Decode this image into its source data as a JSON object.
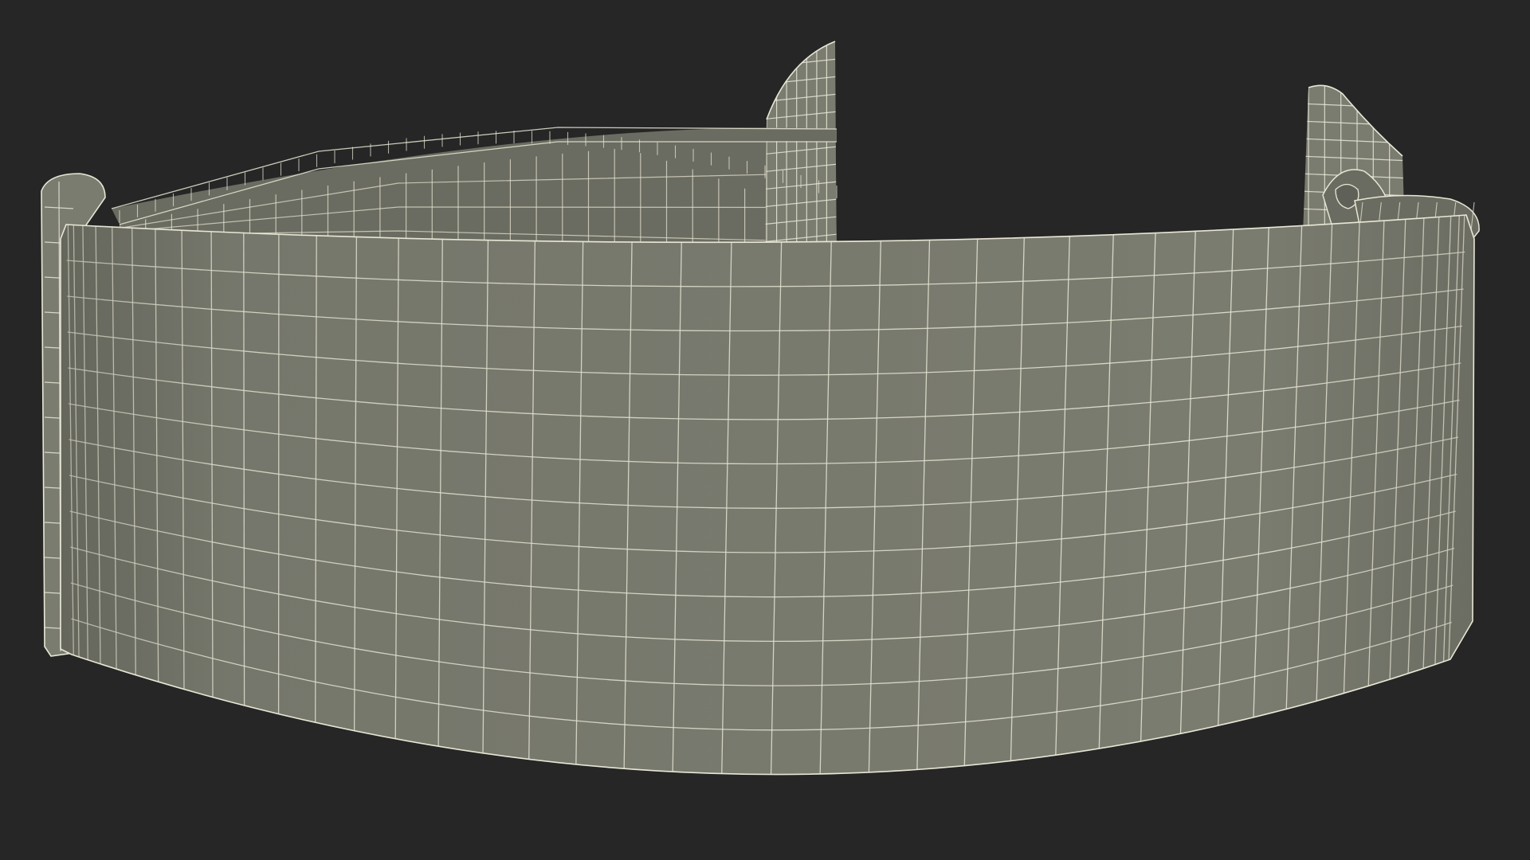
{
  "scene": {
    "subject": "strap-wireframe-render",
    "colors": {
      "background": "#262626",
      "surface": "#7b7c70",
      "surface_inner": "#6b6c61",
      "surface_shadow": "#5f6057",
      "wire": "#e9e7d6"
    }
  }
}
